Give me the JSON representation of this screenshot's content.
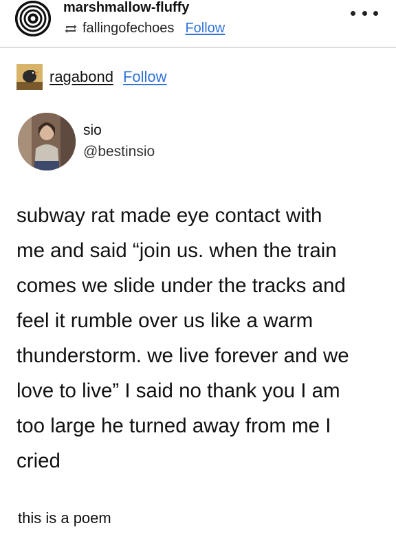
{
  "header": {
    "username": "marshmallow-fluffy",
    "reblogged_from": "fallingofechoes",
    "follow_label": "Follow",
    "reblog_icon": "reblog-icon",
    "more_icon": "more-icon"
  },
  "reblogger": {
    "username": "ragabond",
    "follow_label": "Follow"
  },
  "tweet": {
    "name": "sio",
    "handle": "@bestinsio",
    "lines": [
      "subway rat made eye contact with",
      "me and said “join us. when the train",
      "comes we slide under the tracks and",
      "feel it rumble over us like a warm",
      "thunderstorm. we live forever and we",
      "love to live” I said no thank you I am",
      "too large he turned away from me I",
      "cried"
    ]
  },
  "caption": "this is a poem"
}
